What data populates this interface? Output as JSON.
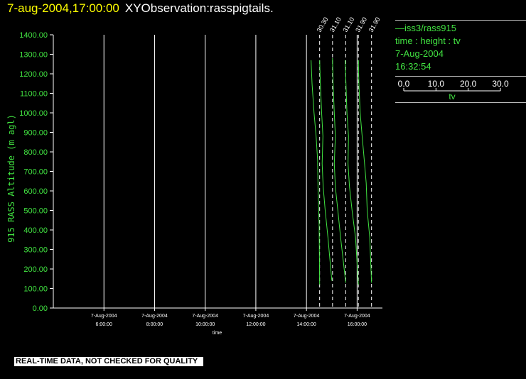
{
  "header": {
    "datetime": "7-aug-2004,17:00:00",
    "title": "XYObservation:rasspigtails."
  },
  "legend": {
    "series": "iss3/rass915",
    "subtitle": "time : height : tv",
    "date": "7-Aug-2004",
    "time": "16:32:54",
    "scale_ticks": [
      "0.0",
      "10.0",
      "20.0",
      "30.0"
    ],
    "scale_label": "tv"
  },
  "footer": "REAL-TIME DATA, NOT CHECKED FOR QUALITY",
  "colors": {
    "axis": "#ffffff",
    "label": "#41e341",
    "data": "#41e341",
    "header_date": "#ffff00"
  },
  "chart_data": {
    "type": "line",
    "ylabel": "915 RASS Altitude (m agl)",
    "xlabel": "time",
    "ylim": [
      0,
      1400
    ],
    "yticks": [
      "0.00",
      "100.00",
      "200.00",
      "300.00",
      "400.00",
      "500.00",
      "600.00",
      "700.00",
      "800.00",
      "900.00",
      "1000.00",
      "1100.00",
      "1200.00",
      "1300.00",
      "1400.00"
    ],
    "xlim_hours": [
      4.0,
      17.0
    ],
    "xticks": [
      {
        "hour": 6,
        "date": "7-Aug-2004",
        "time": "6:00:00"
      },
      {
        "hour": 8,
        "date": "7-Aug-2004",
        "time": "8:00:00"
      },
      {
        "hour": 10,
        "date": "7-Aug-2004",
        "time": "10:00:00"
      },
      {
        "hour": 12,
        "date": "7-Aug-2004",
        "time": "12:00:00"
      },
      {
        "hour": 14,
        "date": "7-Aug-2004",
        "time": "14:00:00"
      },
      {
        "hour": 16,
        "date": "7-Aug-2004",
        "time": "16:00:00"
      }
    ],
    "grid_x_hours": [
      6,
      8,
      10,
      12,
      14,
      16
    ],
    "profile_baselines": [
      {
        "hour": 14.52,
        "label": "30.30"
      },
      {
        "hour": 15.03,
        "label": "31.10"
      },
      {
        "hour": 15.55,
        "label": "31.10"
      },
      {
        "hour": 16.05,
        "label": "31.90"
      },
      {
        "hour": 16.57,
        "label": "31.90"
      }
    ],
    "series": [
      {
        "name": "iss3/rass915",
        "points": [
          [
            14.18,
            1270
          ],
          [
            14.22,
            1150
          ],
          [
            14.3,
            1000
          ],
          [
            14.38,
            880
          ],
          [
            14.44,
            760
          ],
          [
            14.46,
            600
          ],
          [
            14.5,
            420
          ],
          [
            14.52,
            120
          ]
        ]
      },
      {
        "name": "iss3/rass915",
        "points": [
          [
            14.52,
            1270
          ],
          [
            14.55,
            1150
          ],
          [
            14.6,
            1000
          ],
          [
            14.65,
            880
          ],
          [
            14.62,
            740
          ],
          [
            14.66,
            620
          ],
          [
            14.74,
            500
          ],
          [
            14.85,
            360
          ],
          [
            15.0,
            140
          ]
        ]
      },
      {
        "name": "iss3/rass915",
        "points": [
          [
            15.03,
            1280
          ],
          [
            15.05,
            1150
          ],
          [
            15.1,
            1000
          ],
          [
            15.14,
            880
          ],
          [
            15.1,
            740
          ],
          [
            15.14,
            620
          ],
          [
            15.24,
            500
          ],
          [
            15.35,
            360
          ],
          [
            15.55,
            130
          ]
        ]
      },
      {
        "name": "iss3/rass915",
        "points": [
          [
            15.53,
            1270
          ],
          [
            15.56,
            1150
          ],
          [
            15.6,
            1000
          ],
          [
            15.66,
            880
          ],
          [
            15.64,
            740
          ],
          [
            15.7,
            620
          ],
          [
            15.8,
            500
          ],
          [
            15.94,
            360
          ],
          [
            16.05,
            120
          ]
        ]
      },
      {
        "name": "iss3/rass915",
        "points": [
          [
            16.05,
            1270
          ],
          [
            16.07,
            1150
          ],
          [
            16.12,
            1000
          ],
          [
            16.2,
            880
          ],
          [
            16.28,
            760
          ],
          [
            16.36,
            640
          ],
          [
            16.4,
            500
          ],
          [
            16.5,
            360
          ],
          [
            16.57,
            130
          ]
        ]
      }
    ]
  }
}
